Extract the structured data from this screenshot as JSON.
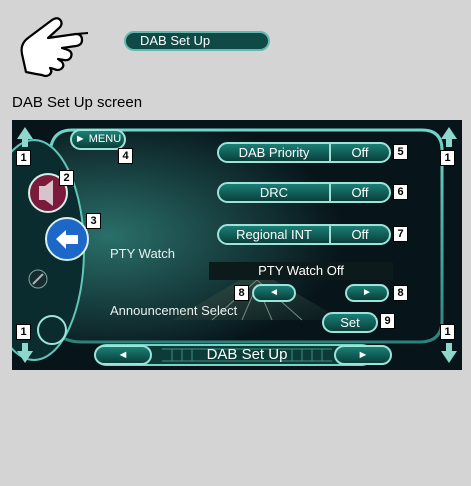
{
  "header_button": {
    "label": "DAB Set Up"
  },
  "caption": "DAB Set Up screen",
  "screen": {
    "menu_label": "► MENU",
    "dab_priority": {
      "label": "DAB Priority",
      "value": "Off"
    },
    "drc": {
      "label": "DRC",
      "value": "Off"
    },
    "regional_int": {
      "label": "Regional INT",
      "value": "Off"
    },
    "pty_watch_label": "PTY Watch",
    "pty_watch_value": "PTY Watch Off",
    "announcement_label": "Announcement Select",
    "set_label": "Set",
    "prev_arrow": "◄",
    "next_arrow": "►",
    "bottom_title": "DAB Set Up"
  },
  "callouts": [
    "1",
    "1",
    "1",
    "1",
    "2",
    "3",
    "4",
    "5",
    "6",
    "7",
    "8",
    "8",
    "9"
  ]
}
